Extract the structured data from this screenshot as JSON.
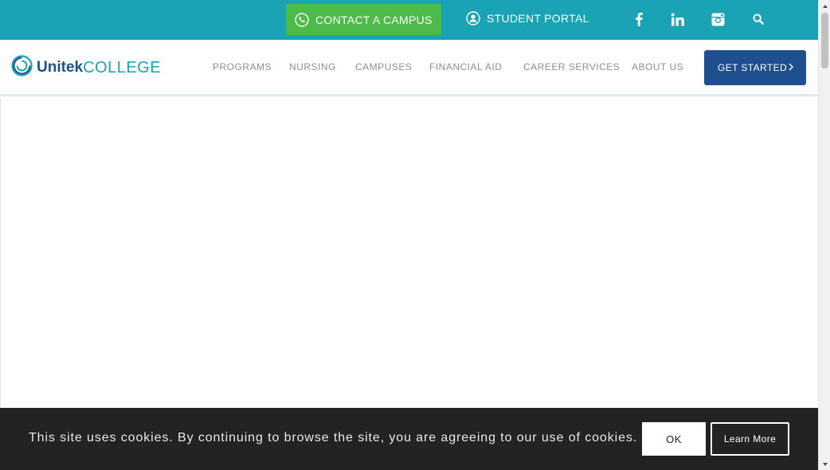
{
  "topbar": {
    "contact_label": "CONTACT A CAMPUS",
    "portal_label": "STUDENT PORTAL",
    "social": [
      "facebook-icon",
      "linkedin-icon",
      "instagram-icon",
      "search-icon"
    ]
  },
  "brand": {
    "logo_word1": "Unitek",
    "logo_word2": "COLLEGE"
  },
  "nav": {
    "items": [
      "PROGRAMS",
      "NURSING",
      "CAMPUSES",
      "FINANCIAL AID",
      "CAREER SERVICES",
      "ABOUT US"
    ],
    "cta_label": "GET STARTED"
  },
  "cookie": {
    "message": "This site uses cookies. By continuing to browse the site, you are agreeing to our use of cookies.",
    "ok_label": "OK",
    "learn_label": "Learn More"
  },
  "colors": {
    "topbar": "#1aa3b5",
    "contact_button": "#4dba4a",
    "cta": "#1f4f8e",
    "cookie_bar": "#232323"
  }
}
